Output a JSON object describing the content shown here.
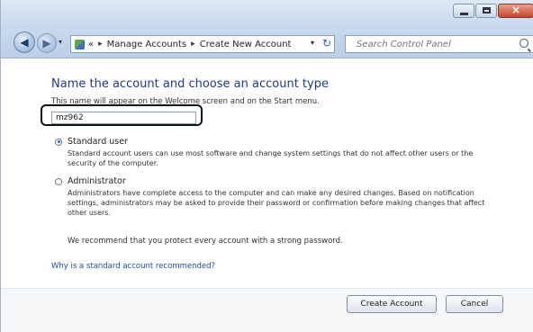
{
  "window": {
    "controls": {
      "minimize": "minimize",
      "maximize": "maximize",
      "close": "×"
    }
  },
  "nav": {
    "back_icon": "◀",
    "forward_icon": "▶",
    "dropdown_icon": "▾"
  },
  "address": {
    "icon": "control-panel-icon",
    "separator": "▸",
    "overflow": "«",
    "crumbs": [
      "Manage Accounts",
      "Create New Account"
    ],
    "dropdown_icon": "▾",
    "refresh_icon": "↻"
  },
  "search": {
    "placeholder": "Search Control Panel"
  },
  "content": {
    "heading": "Name the account and choose an account type",
    "help_text": "This name will appear on the Welcome screen and on the Start menu.",
    "account_name": "mz962",
    "options": [
      {
        "label": "Standard user",
        "checked": true,
        "description": "Standard account users can use most software and change system settings that do not affect other users or the security of the computer."
      },
      {
        "label": "Administrator",
        "checked": false,
        "description": "Administrators have complete access to the computer and can make any desired changes. Based on notification settings, administrators may be asked to provide their password or confirmation before making changes that affect other users."
      }
    ],
    "recommendation": "We recommend that you protect every account with a strong password.",
    "help_link": "Why is a standard account recommended?"
  },
  "buttons": {
    "create": "Create Account",
    "cancel": "Cancel"
  },
  "colors": {
    "heading": "#1e3a8a",
    "link": "#1a4fb0",
    "titlebar": "#c9d9ee",
    "highlight_outline": "#111111"
  }
}
